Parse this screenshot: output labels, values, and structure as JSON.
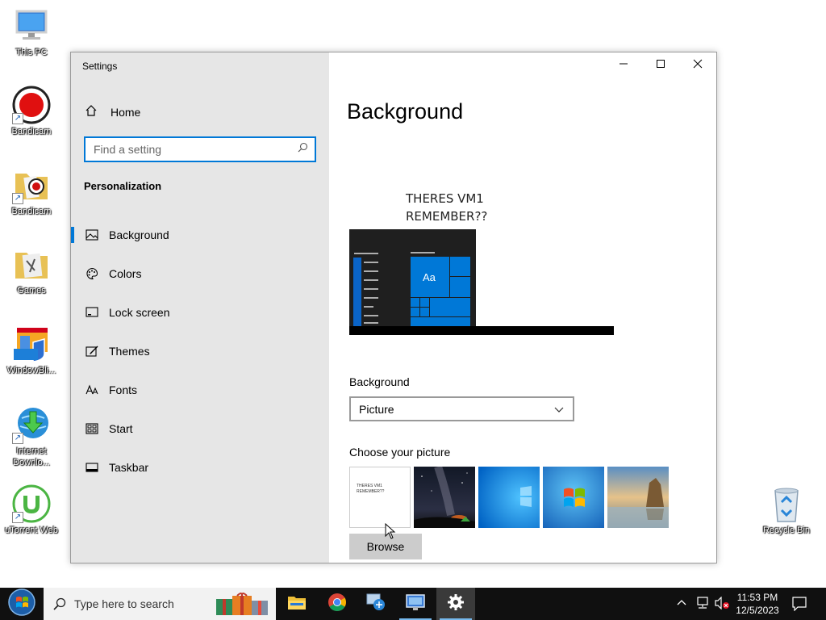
{
  "desktop": {
    "icons": [
      {
        "label": "This PC"
      },
      {
        "label": "Bandicam"
      },
      {
        "label": "Bandicam"
      },
      {
        "label": "Games"
      },
      {
        "label": "WindowBli..."
      },
      {
        "label": "Internet Downlo..."
      },
      {
        "label": "uTorrent Web"
      },
      {
        "label": "Recycle Bin"
      }
    ]
  },
  "window": {
    "title": "Settings",
    "controls": {
      "minimize": "minimize",
      "maximize": "maximize",
      "close": "close"
    }
  },
  "sidebar": {
    "home_label": "Home",
    "search_placeholder": "Find a setting",
    "section_title": "Personalization",
    "items": [
      {
        "label": "Background",
        "icon": "picture-icon",
        "active": true
      },
      {
        "label": "Colors",
        "icon": "palette-icon",
        "active": false
      },
      {
        "label": "Lock screen",
        "icon": "lock-screen-icon",
        "active": false
      },
      {
        "label": "Themes",
        "icon": "themes-icon",
        "active": false
      },
      {
        "label": "Fonts",
        "icon": "fonts-icon",
        "active": false
      },
      {
        "label": "Start",
        "icon": "start-icon",
        "active": false
      },
      {
        "label": "Taskbar",
        "icon": "taskbar-icon",
        "active": false
      }
    ]
  },
  "main": {
    "title": "Background",
    "preview_line1": "THERES VM1",
    "preview_line2": "REMEMBER??",
    "preview_tile_label": "Aa",
    "background_label": "Background",
    "background_value": "Picture",
    "choose_label": "Choose your picture",
    "thumb1_line1": "THERES VM1",
    "thumb1_line2": "REMEMBER??",
    "browse_label": "Browse"
  },
  "taskbar": {
    "search_placeholder": "Type here to search",
    "time": "11:53 PM",
    "date": "12/5/2023"
  },
  "colors": {
    "accent": "#0078d7",
    "sidebar_bg": "#e6e6e6",
    "taskbar_bg": "#101010"
  }
}
